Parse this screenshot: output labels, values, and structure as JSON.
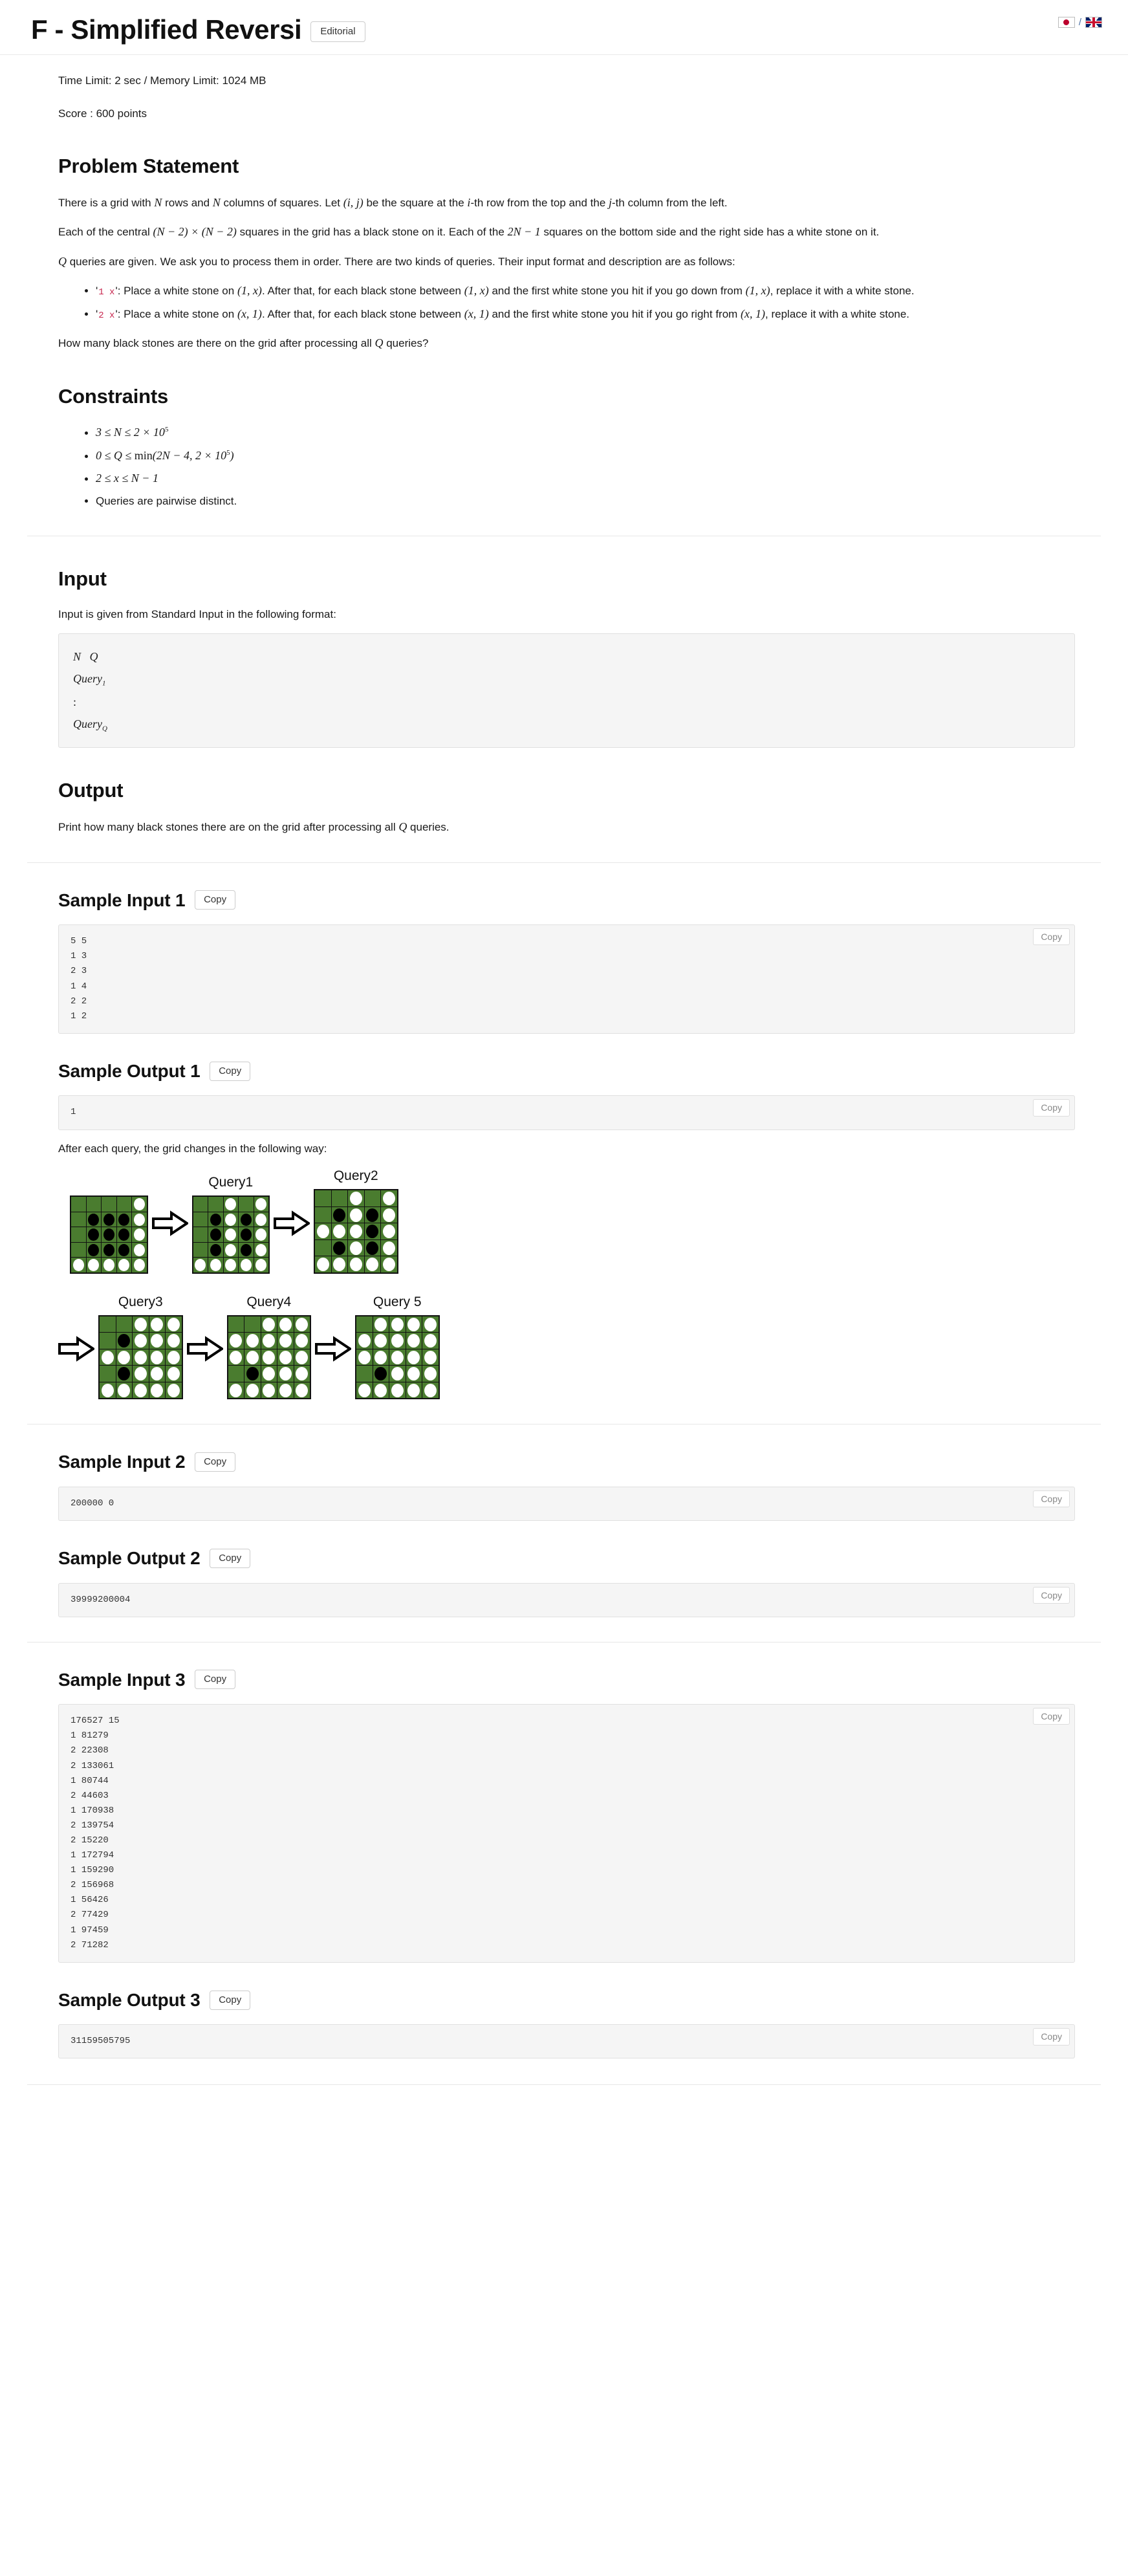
{
  "header": {
    "title": "F - Simplified Reversi",
    "editorial_label": "Editorial",
    "lang_ja_icon": "japan-flag-icon",
    "lang_separator": "/",
    "lang_en_icon": "uk-flag-icon"
  },
  "meta": {
    "limits": "Time Limit: 2 sec / Memory Limit: 1024 MB",
    "score": "Score : 600 points"
  },
  "problem_statement": {
    "heading": "Problem Statement",
    "p1_a": "There is a grid with ",
    "p1_n1": "N",
    "p1_b": " rows and ",
    "p1_n2": "N",
    "p1_c": " columns of squares. Let ",
    "p1_ij": "(i, j)",
    "p1_d": " be the square at the ",
    "p1_i": "i",
    "p1_e": "-th row from the top and the ",
    "p1_j": "j",
    "p1_f": "-th column from the left.",
    "p2_a": "Each of the central ",
    "p2_m1": "(N − 2) × (N − 2)",
    "p2_b": " squares in the grid has a black stone on it. Each of the ",
    "p2_m2": "2N − 1",
    "p2_c": " squares on the bottom side and the right side has a white stone on it.",
    "p3_q": "Q",
    "p3_text": " queries are given. We ask you to process them in order. There are two kinds of queries. Their input format and description are as follows:",
    "bullets": [
      {
        "code": "1 x",
        "before_quote": "'",
        "after_quote": "'",
        "text_a": ": Place a white stone on ",
        "m1": "(1, x)",
        "text_b": ". After that, for each black stone between ",
        "m2": "(1, x)",
        "text_c": " and the first white stone you hit if you go down from ",
        "m3": "(1, x)",
        "text_d": ", replace it with a white stone."
      },
      {
        "code": "2 x",
        "before_quote": "'",
        "after_quote": "'",
        "text_a": ": Place a white stone on ",
        "m1": "(x, 1)",
        "text_b": ". After that, for each black stone between ",
        "m2": "(x, 1)",
        "text_c": " and the first white stone you hit if you go right from ",
        "m3": "(x, 1)",
        "text_d": ", replace it with a white stone."
      }
    ],
    "p4_a": "How many black stones are there on the grid after processing all ",
    "p4_q": "Q",
    "p4_b": " queries?"
  },
  "constraints": {
    "heading": "Constraints",
    "items": [
      "3 ≤ N ≤ 2 × 10^5",
      "0 ≤ Q ≤ min(2N − 4, 2 × 10^5)",
      "2 ≤ x ≤ N − 1",
      "Queries are pairwise distinct."
    ]
  },
  "input_section": {
    "heading": "Input",
    "description": "Input is given from Standard Input in the following format:",
    "format_lines": [
      "N   Q",
      "Query_1",
      ":",
      "Query_Q"
    ]
  },
  "output_section": {
    "heading": "Output",
    "description_a": "Print how many black stones there are on the grid after processing all ",
    "description_q": "Q",
    "description_b": " queries."
  },
  "copy_label": "Copy",
  "samples": [
    {
      "input_title": "Sample Input 1",
      "input_text": "5 5\n1 3\n2 3\n1 4\n2 2\n1 2",
      "output_title": "Sample Output 1",
      "output_text": "1"
    },
    {
      "input_title": "Sample Input 2",
      "input_text": "200000 0",
      "output_title": "Sample Output 2",
      "output_text": "39999200004"
    },
    {
      "input_title": "Sample Input 3",
      "input_text": "176527 15\n1 81279\n2 22308\n2 133061\n1 80744\n2 44603\n1 170938\n2 139754\n2 15220\n1 172794\n1 159290\n2 156968\n1 56426\n2 77429\n1 97459\n2 71282",
      "output_title": "Sample Output 3",
      "output_text": "31159505795"
    }
  ],
  "figure": {
    "note": "After each query, the grid changes in the following way:",
    "arrow_icon": "right-arrow-icon",
    "boards": [
      {
        "label": "",
        "rows": [
          [
            "",
            "",
            "",
            "",
            "w"
          ],
          [
            "",
            "b",
            "b",
            "b",
            "w"
          ],
          [
            "",
            "b",
            "b",
            "b",
            "w"
          ],
          [
            "",
            "b",
            "b",
            "b",
            "w"
          ],
          [
            "w",
            "w",
            "w",
            "w",
            "w"
          ]
        ]
      },
      {
        "label": "Query1",
        "rows": [
          [
            "",
            "",
            "w",
            "",
            "w"
          ],
          [
            "",
            "b",
            "w",
            "b",
            "w"
          ],
          [
            "",
            "b",
            "w",
            "b",
            "w"
          ],
          [
            "",
            "b",
            "w",
            "b",
            "w"
          ],
          [
            "w",
            "w",
            "w",
            "w",
            "w"
          ]
        ]
      },
      {
        "label": "Query2",
        "rows": [
          [
            "",
            "",
            "w",
            "",
            "w"
          ],
          [
            "",
            "b",
            "w",
            "b",
            "w"
          ],
          [
            "w",
            "w",
            "w",
            "b",
            "w"
          ],
          [
            "",
            "b",
            "w",
            "b",
            "w"
          ],
          [
            "w",
            "w",
            "w",
            "w",
            "w"
          ]
        ]
      },
      {
        "label": "Query3",
        "rows": [
          [
            "",
            "",
            "w",
            "w",
            "w"
          ],
          [
            "",
            "b",
            "w",
            "w",
            "w"
          ],
          [
            "w",
            "w",
            "w",
            "w",
            "w"
          ],
          [
            "",
            "b",
            "w",
            "w",
            "w"
          ],
          [
            "w",
            "w",
            "w",
            "w",
            "w"
          ]
        ]
      },
      {
        "label": "Query4",
        "rows": [
          [
            "",
            "",
            "w",
            "w",
            "w"
          ],
          [
            "w",
            "w",
            "w",
            "w",
            "w"
          ],
          [
            "w",
            "w",
            "w",
            "w",
            "w"
          ],
          [
            "",
            "b",
            "w",
            "w",
            "w"
          ],
          [
            "w",
            "w",
            "w",
            "w",
            "w"
          ]
        ]
      },
      {
        "label": "Query 5",
        "rows": [
          [
            "",
            "w",
            "w",
            "w",
            "w"
          ],
          [
            "w",
            "w",
            "w",
            "w",
            "w"
          ],
          [
            "w",
            "w",
            "w",
            "w",
            "w"
          ],
          [
            "",
            "b",
            "w",
            "w",
            "w"
          ],
          [
            "w",
            "w",
            "w",
            "w",
            "w"
          ]
        ]
      }
    ]
  },
  "colors": {
    "board_green": "#4a7c2f",
    "stone_black": "#000000",
    "stone_white": "#ffffff",
    "code_accent": "#c7254e"
  }
}
